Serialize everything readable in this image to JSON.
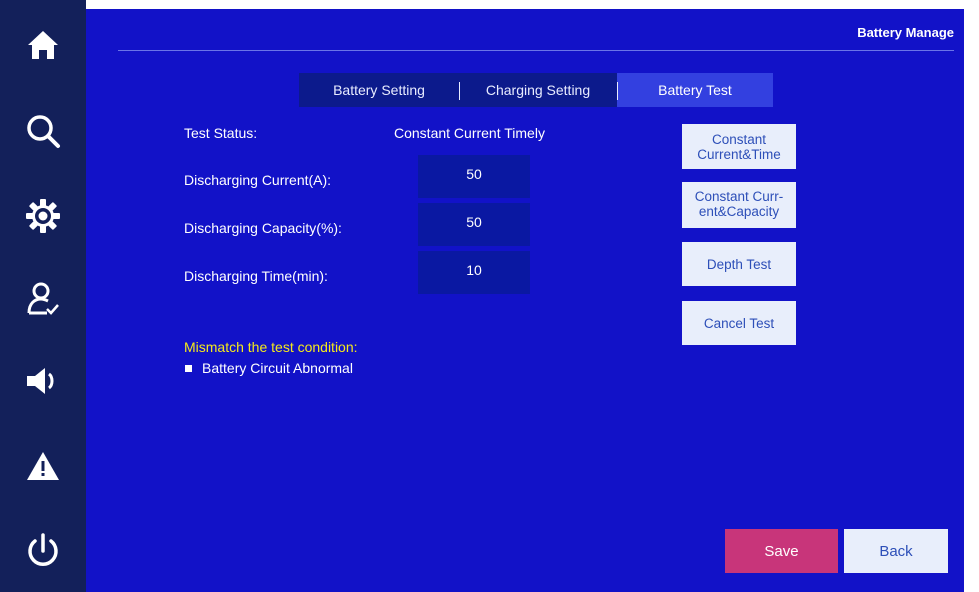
{
  "header": {
    "title": "Battery Manage"
  },
  "sidebar": {
    "items": [
      {
        "icon": "home-icon"
      },
      {
        "icon": "search-icon"
      },
      {
        "icon": "gear-icon"
      },
      {
        "icon": "user-check-icon"
      },
      {
        "icon": "speaker-icon"
      },
      {
        "icon": "warning-icon"
      },
      {
        "icon": "power-icon"
      }
    ]
  },
  "tabs": [
    {
      "label": "Battery Setting",
      "active": false
    },
    {
      "label": "Charging Setting",
      "active": false
    },
    {
      "label": "Battery Test",
      "active": true
    }
  ],
  "form": {
    "test_status_label": "Test Status:",
    "test_status_value": "Constant Current Timely",
    "discharging_current_label": "Discharging Current(A):",
    "discharging_current_value": "50",
    "discharging_capacity_label": "Discharging Capacity(%):",
    "discharging_capacity_value": "50",
    "discharging_time_label": "Discharging Time(min):",
    "discharging_time_value": "10"
  },
  "test_buttons": {
    "constant_current_time_line1": "Constant",
    "constant_current_time_line2": "Current&Time",
    "constant_current_capacity_line1": "Constant Curr-",
    "constant_current_capacity_line2": "ent&Capacity",
    "depth_test": "Depth Test",
    "cancel_test": "Cancel Test"
  },
  "warning": {
    "title": "Mismatch the test condition:",
    "items": [
      "Battery Circuit Abnormal"
    ]
  },
  "footer": {
    "save_label": "Save",
    "back_label": "Back"
  },
  "colors": {
    "sidebar_bg": "#13205a",
    "main_bg": "#1212c8",
    "active_tab": "#3340e0",
    "warning_text": "#f5ea1a",
    "save_button": "#c8357a",
    "light_button": "#e8eefb"
  }
}
